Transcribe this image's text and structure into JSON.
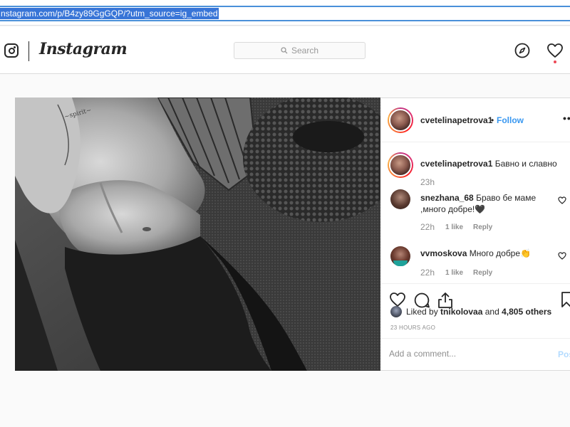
{
  "browser": {
    "url": "nstagram.com/p/B4zy89GgGQP/?utm_source=ig_embed"
  },
  "header": {
    "brand": "Instagram",
    "search_placeholder": "Search"
  },
  "post": {
    "author": {
      "username": "cvetelinapetrova1",
      "separator": "•",
      "follow_label": "Follow",
      "more_label": "•••"
    },
    "caption": {
      "username": "cvetelinapetrova1",
      "text": "Бавно и славно",
      "time": "23h"
    },
    "comments": [
      {
        "username": "snezhana_68",
        "text": "Браво бе маме ,много добре!🖤",
        "time": "22h",
        "likes": "1 like",
        "reply": "Reply"
      },
      {
        "username": "vvmoskova",
        "text": "Много добре👏",
        "time": "22h",
        "likes": "1 like",
        "reply": "Reply"
      }
    ],
    "likes": {
      "prefix": "Liked by",
      "user": "tnikolovaa",
      "conj": "and",
      "others": "4,805 others"
    },
    "timestamp": "23 HOURS AGO",
    "comment_placeholder": "Add a comment...",
    "post_label": "Post"
  },
  "icons": [
    "instagram-camera-icon",
    "search-icon",
    "compass-icon",
    "heart-icon",
    "comment-icon",
    "share-icon",
    "bookmark-icon"
  ],
  "colors": {
    "link_blue": "#3897f0",
    "notification_red": "#ed4956",
    "url_highlight": "#3875d7"
  }
}
